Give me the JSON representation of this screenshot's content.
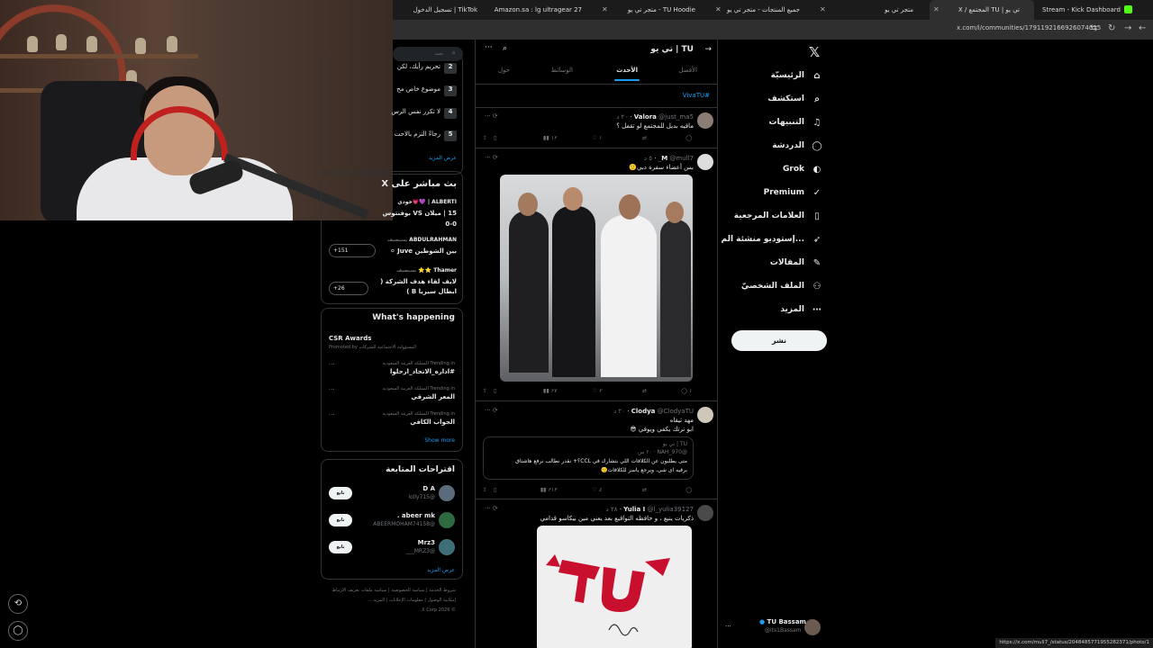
{
  "browser": {
    "tabs": [
      {
        "title": "Stream - Kick Dashboard",
        "color": "#53fc18"
      },
      {
        "title": "تي يو | TU المجتمع / X",
        "color": "#ffffff"
      },
      {
        "title": "متجر تي يو",
        "color": "#888888"
      },
      {
        "title": "جميع المنتجات - متجر تي يو",
        "color": "#888888"
      },
      {
        "title": "TU Hoodie - متجر تي يو",
        "color": "#888888"
      },
      {
        "title": "Amazon.sa : lg ultragear 27",
        "color": "#dddddd"
      },
      {
        "title": "TikTok | تسجيل الدخول",
        "color": "#dddddd"
      }
    ],
    "url": "x.com/i/communities/1791192166926074025",
    "status_url": "https://x.com/mull7_/status/2048485771955282371/photo/1"
  },
  "nav": {
    "items": [
      {
        "label": "الرئيسيّة",
        "icon": "home-icon",
        "glyph": "⌂"
      },
      {
        "label": "استكشف",
        "icon": "search-icon",
        "glyph": "⌕"
      },
      {
        "label": "التنبيهات",
        "icon": "bell-icon",
        "glyph": "🔔"
      },
      {
        "label": "الدردشة",
        "icon": "chat-icon",
        "glyph": "◯"
      },
      {
        "label": "Grok",
        "icon": "grok-icon",
        "glyph": "◐"
      },
      {
        "label": "Premium",
        "icon": "premium-icon",
        "glyph": "✓"
      },
      {
        "label": "العلامات المرجعية",
        "icon": "bookmark-icon",
        "glyph": "▯"
      },
      {
        "label": "إستوديو منشئة الم...",
        "icon": "rocket-icon",
        "glyph": "➶"
      },
      {
        "label": "المقالات",
        "icon": "article-icon",
        "glyph": "✎"
      },
      {
        "label": "الملف الشخصيّ",
        "icon": "person-icon",
        "glyph": "⚇"
      },
      {
        "label": "المزيد",
        "icon": "more-circle-icon",
        "glyph": "⋯"
      }
    ],
    "post_button": "نشر",
    "profile": {
      "name": "TU Bassam",
      "handle": "@its1Bassam",
      "more": "..."
    }
  },
  "feed": {
    "title": "TU | تي يو",
    "tabs": [
      "الأفضل",
      "الأحدث",
      "الوسائط",
      "حول"
    ],
    "active_tab": 1,
    "hashtag": "#VivaTU",
    "tweets": [
      {
        "name": "Valora",
        "handle": "@just_ma5",
        "time": "٢٠ د",
        "text": "ماقيه بديل للمجتمع لو تقفل ؟",
        "replies": "",
        "retweets": "",
        "likes": "١",
        "views": "١٢",
        "avatar": "#8a7d74"
      },
      {
        "name": "M",
        "handle": "@mull7_",
        "time": "٥ د",
        "text": "بس أعضاء سفرة دبي🙂",
        "replies": "١",
        "retweets": "",
        "likes": "٢",
        "views": "٢٧",
        "avatar": "#dddddd"
      },
      {
        "name": "Clodya",
        "handle": "@ClodyaTU",
        "time": "٢٠ د",
        "text": "مهد ثيقاه",
        "text2": "ابو ترتك يكفي ويوفي 😎",
        "quote_author": "TU | تي يو",
        "quote_handle": "@NAH_970",
        "quote_time": "٢٠ س",
        "quote_text": "متى يطلبون عن الكلافات اللي بتشارك في CCL؟+ نقدر نطالب نرفع هاشتاق",
        "quote_text2": "برقيه اى شي، ويرجع ياسر للكلافات🙂",
        "replies": "",
        "retweets": "",
        "likes": "٤",
        "views": "٢١٣",
        "avatar": "#cfc7b8"
      },
      {
        "name": "Yulia I",
        "handle": "@l_yulia39127",
        "time": "٢٨ د",
        "text": "ذكريات ينبع ، و حافظه التواقيع بعد يعني مين بيكاسو قدامي",
        "avatar": "#4a4a4a"
      }
    ]
  },
  "sidebar": {
    "search_placeholder": "بحث",
    "trends_top": [
      {
        "num": "2",
        "text": "تحريم رأيك، لكن"
      },
      {
        "num": "3",
        "text": "موضوع خاص مح"
      },
      {
        "num": "4",
        "text": "لا تكرر نفس الرس"
      },
      {
        "num": "5",
        "text": "رجاءً التزم بالاحت"
      }
    ],
    "show_more_ar": "عرض المزيد",
    "live_title": "بث مباشر على X",
    "live": [
      {
        "user": "ALBERTI | 💜💗خودي",
        "text": "15 | ميلان VS بوفنتوس",
        "text2": "0-0",
        "count": ""
      },
      {
        "user": "ABDULRAHMAN",
        "suffix": "يستضيف",
        "text": "بين الشوطين Juve ⚪",
        "count": "+151"
      },
      {
        "user": "Thamer ⭐⭐",
        "suffix": "يستضيف",
        "text": "لايف لقاء هدف الشركة (",
        "text2": "ابطال سيريا B )",
        "count": "+26"
      }
    ],
    "happening_title": "What's happening",
    "promo": {
      "title": "CSR Awards",
      "sub": "Promoted by المسؤولية الاجتماعية للشركات"
    },
    "trends": [
      {
        "context": "Trending in المملكة العربية السعودية",
        "tag": "#اداره_الاتحاد_ارحلوا"
      },
      {
        "context": "Trending in المملكة العربية السعودية",
        "tag": "المعر الشرقي"
      },
      {
        "context": "Trending in المملكة العربية السعودية",
        "tag": "الجواب الكافي"
      }
    ],
    "show_more_en": "Show more",
    "follow_title": "اقتراحات المتابعة",
    "follow": [
      {
        "name": "D A",
        "handle": "@lolly715",
        "button": "تابع",
        "avatar": "#5a6b7c"
      },
      {
        "name": "abeer mk .",
        "handle": "@ABEERMOHAM74158",
        "button": "تابع",
        "avatar": "#2d6a3e"
      },
      {
        "name": "Mrz3",
        "handle": "@MRZ3___",
        "button": "تابع",
        "avatar": "#3e6e7a"
      }
    ],
    "footer": [
      "شروط الخدمة",
      "سياسة الخصوصية",
      "سياسة ملفات تعريف الارتباط",
      "إمكانية الوصول",
      "معلومات الإعلانات",
      "المزيد ...",
      "© 2026 X Corp."
    ]
  }
}
